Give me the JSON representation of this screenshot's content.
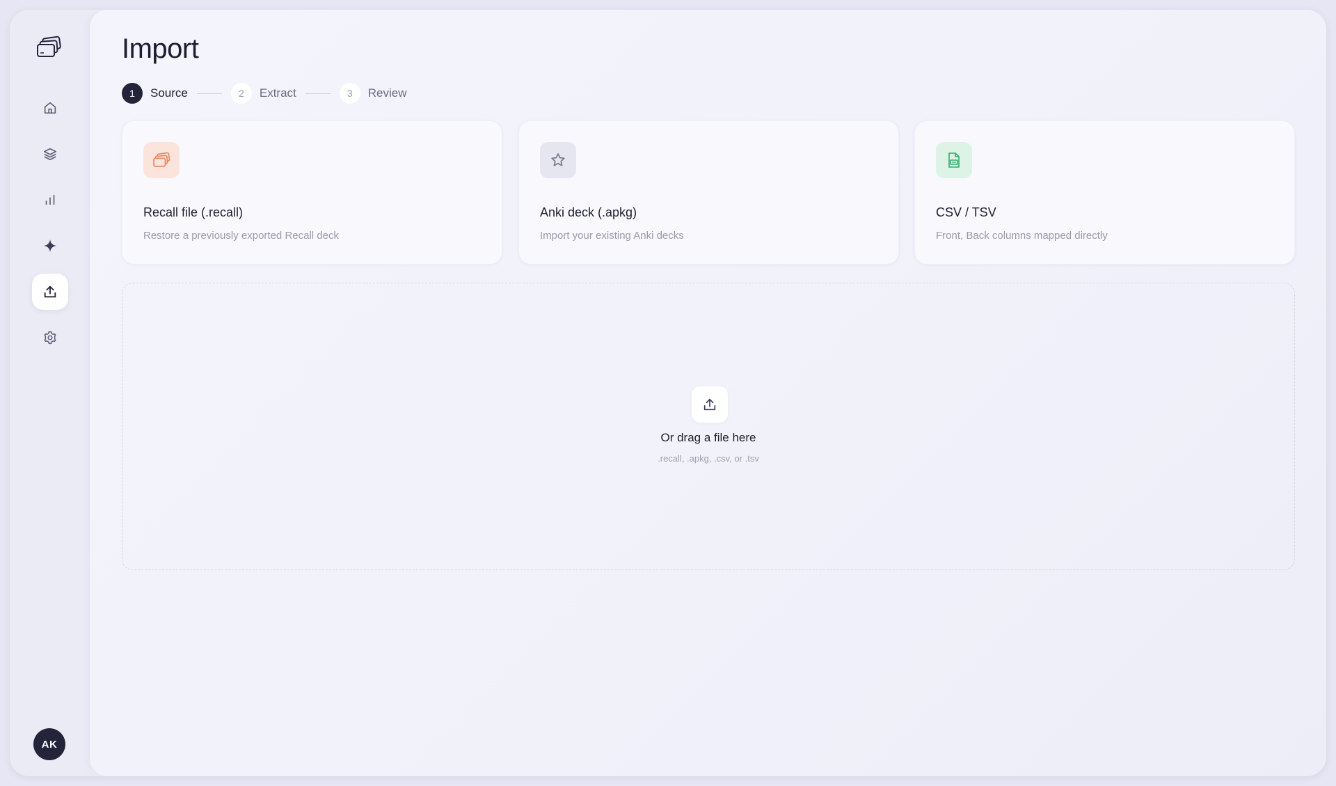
{
  "sidebar": {
    "items": [
      {
        "name": "home",
        "icon": "home-icon"
      },
      {
        "name": "decks",
        "icon": "layers-icon"
      },
      {
        "name": "stats",
        "icon": "bar-chart-icon"
      },
      {
        "name": "ai",
        "icon": "sparkle-icon"
      },
      {
        "name": "import",
        "icon": "upload-icon",
        "active": true
      },
      {
        "name": "settings",
        "icon": "gear-icon"
      }
    ],
    "avatar_initials": "AK"
  },
  "page": {
    "title": "Import"
  },
  "steps": [
    {
      "number": "1",
      "label": "Source",
      "active": true
    },
    {
      "number": "2",
      "label": "Extract",
      "active": false
    },
    {
      "number": "3",
      "label": "Review",
      "active": false
    }
  ],
  "sources": [
    {
      "title": "Recall file (.recall)",
      "description": "Restore a previously exported Recall deck",
      "icon": "cards-icon",
      "icon_bg": "#fbe4dc",
      "icon_color": "#e8855c"
    },
    {
      "title": "Anki deck (.apkg)",
      "description": "Import your existing Anki decks",
      "icon": "star-icon",
      "icon_bg": "#e6e6f1",
      "icon_color": "#7b7c92"
    },
    {
      "title": "CSV / TSV",
      "description": "Front, Back columns mapped directly",
      "icon": "csv-file-icon",
      "icon_bg": "#dcf3e6",
      "icon_color": "#2fae6b"
    }
  ],
  "dropzone": {
    "title": "Or drag a file here",
    "hint": ".recall, .apkg, .csv, or .tsv"
  }
}
